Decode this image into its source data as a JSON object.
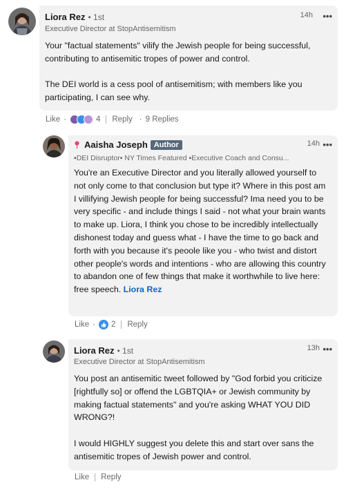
{
  "comments": [
    {
      "author": "Liora Rez",
      "degree": "• 1st",
      "headline": "Executive Director at StopAntisemitism",
      "time": "14h",
      "paragraphs": [
        "Your \"factual statements\" vilify the Jewish people for being successful, contributing to antisemitic tropes of power and control.",
        "The DEI world is a cess pool of antisemitism; with members like you participating, I can see why."
      ],
      "actions": {
        "like": "Like",
        "reaction_count": "4",
        "reply": "Reply",
        "replies": "9 Replies"
      }
    },
    {
      "author": "Aaisha Joseph",
      "badge": "Author",
      "headline": "▪DEI Disruptor▪ NY Times Featured ▪Executive Coach and Consu...",
      "time": "14h",
      "text": "You're an Executive Director and you literally allowed yourself to not only come to that conclusion but type it? Where in this post am I villifying Jewish people for being successful? Ima need you to be very specific - and include things I said - not what your brain wants to make up. Liora, I think you chose to be incredibly intellectually dishonest today and guess what - I have the time to go back and forth with you because it's peoole like you - who twist and distort other people's words and intentions - who are allowing this country to abandon one of few things that make it worthwhile to live here: free speech.",
      "mention": "Liora Rez",
      "actions": {
        "like": "Like",
        "reaction_count": "2",
        "reply": "Reply"
      }
    },
    {
      "author": "Liora Rez",
      "degree": "• 1st",
      "headline": "Executive Director at StopAntisemitism",
      "time": "13h",
      "paragraphs": [
        "You post an antisemitic tweet followed by \"God forbid you criticize [rightfully so] or offend the LGBTQIA+ or Jewish community by making factual statements\" and you're asking WHAT YOU DID WRONG?!",
        "I would HIGHLY suggest you delete this and start over sans the antisemitic tropes of Jewish power and control."
      ],
      "actions": {
        "like": "Like",
        "reply": "Reply"
      }
    }
  ],
  "more_icon": "•••",
  "colors": {
    "bubble": "#f2f2f2",
    "link": "#0a66c2",
    "author_badge": "#56687a"
  }
}
